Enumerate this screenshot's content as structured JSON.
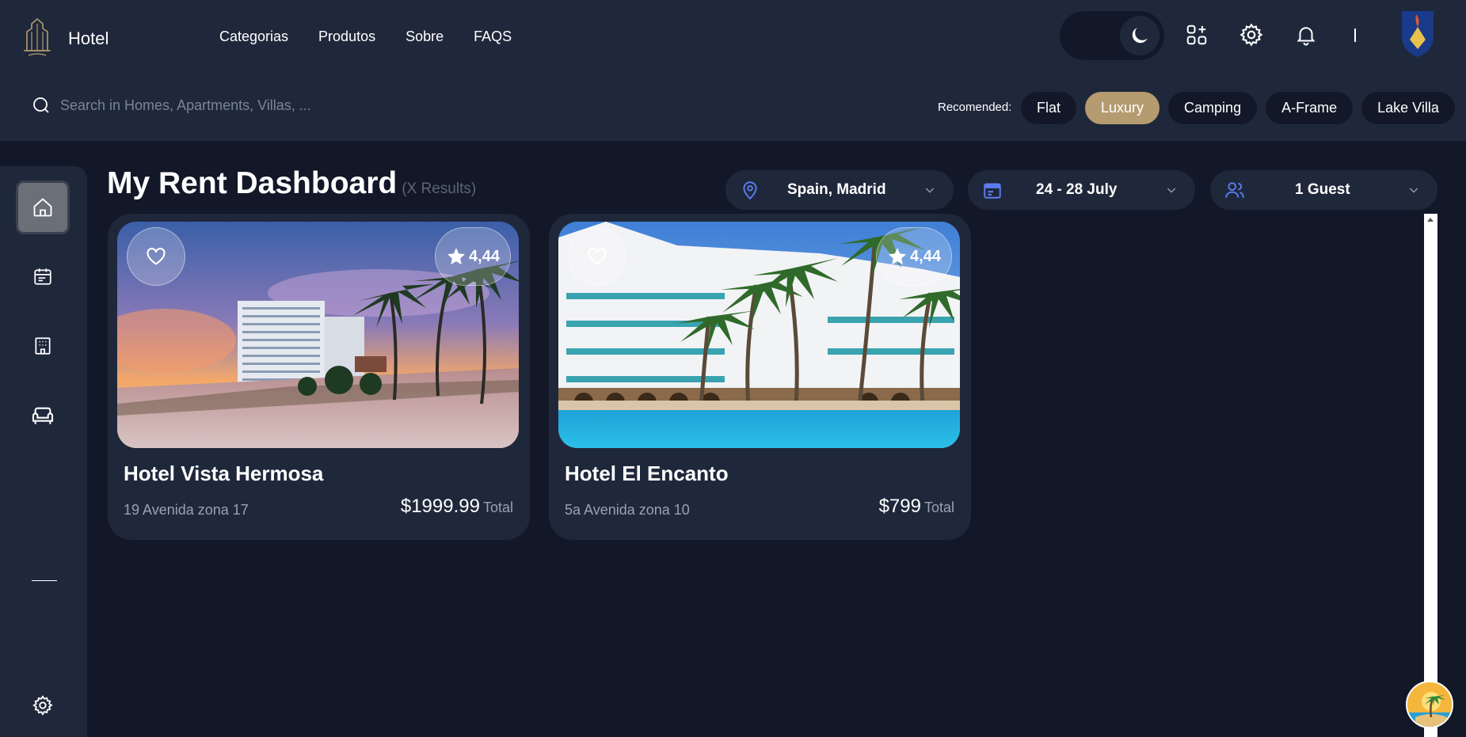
{
  "header": {
    "brand": "Hotel",
    "nav": [
      "Categorias",
      "Produtos",
      "Sobre",
      "FAQS"
    ],
    "icons": [
      "moon-icon",
      "apps-add-icon",
      "gear-icon",
      "bell-icon"
    ]
  },
  "search": {
    "placeholder": "Search in Homes, Apartments, Villas, ..."
  },
  "recommended": {
    "label": "Recomended:",
    "chips": [
      "Flat",
      "Luxury",
      "Camping",
      "A-Frame",
      "Lake Villa"
    ],
    "active": "Luxury"
  },
  "sidebar": {
    "items": [
      "home-icon",
      "calendar-icon",
      "building-icon",
      "sofa-icon"
    ],
    "bottom": "gear-icon"
  },
  "main": {
    "title": "My Rent Dashboard",
    "results": "(X Results)",
    "filters": {
      "location": "Spain, Madrid",
      "dates": "24 - 28 July",
      "guests": "1 Guest"
    }
  },
  "cards": [
    {
      "name": "Hotel Vista Hermosa",
      "address": "19 Avenida zona 17",
      "price": "$1999.99",
      "total_label": "Total",
      "rating": "4,44"
    },
    {
      "name": "Hotel El Encanto",
      "address": "5a Avenida zona 10",
      "price": "$799",
      "total_label": "Total",
      "rating": "4,44"
    }
  ],
  "colors": {
    "background": "#121828",
    "panel": "#1f283b",
    "accent": "#b59b70",
    "icon_blue": "#5b7cf0"
  }
}
